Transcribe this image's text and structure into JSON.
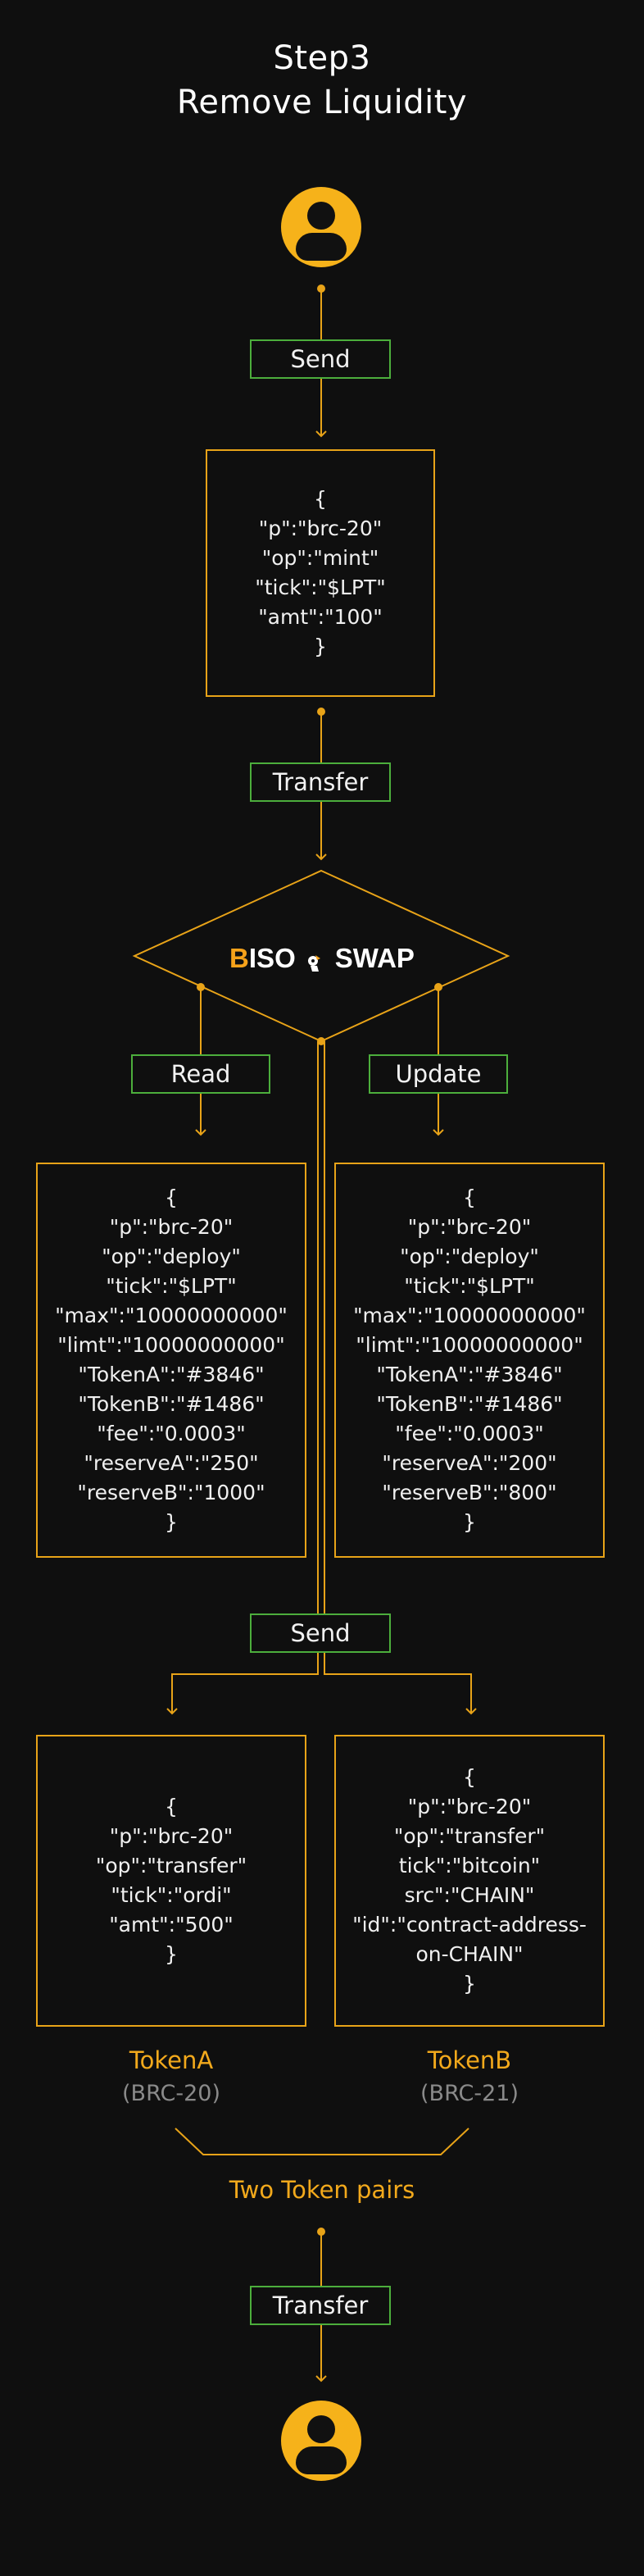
{
  "title": {
    "line1": "Step3",
    "line2": "Remove Liquidity"
  },
  "steps": {
    "send_top": "Send",
    "transfer_top": "Transfer",
    "read": "Read",
    "update": "Update",
    "send_mid": "Send",
    "transfer_bottom": "Transfer"
  },
  "logo": {
    "prefix_letter": "B",
    "prefix_rest": "ISO",
    "suffix": "SWAP",
    "mascot": "pony-icon"
  },
  "boxes": {
    "mint": [
      "{",
      "\"p\":\"brc-20\"",
      "\"op\":\"mint\"",
      "\"tick\":\"$LPT\"",
      "\"amt\":\"100\"",
      "}"
    ],
    "deploy_left": [
      "{",
      "\"p\":\"brc-20\"",
      "\"op\":\"deploy\"",
      "\"tick\":\"$LPT\"",
      "\"max\":\"10000000000\"",
      "\"limt\":\"10000000000\"",
      "\"TokenA\":\"#3846\"",
      "\"TokenB\":\"#1486\"",
      "\"fee\":\"0.0003\"",
      "\"reserveA\":\"250\"",
      "\"reserveB\":\"1000\"",
      "}"
    ],
    "deploy_right": [
      "{",
      "\"p\":\"brc-20\"",
      "\"op\":\"deploy\"",
      "\"tick\":\"$LPT\"",
      "\"max\":\"10000000000\"",
      "\"limt\":\"10000000000\"",
      "\"TokenA\":\"#3846\"",
      "\"TokenB\":\"#1486\"",
      "\"fee\":\"0.0003\"",
      "\"reserveA\":\"200\"",
      "\"reserveB\":\"800\"",
      "}"
    ],
    "token_a": [
      "{",
      "\"p\":\"brc-20\"",
      "\"op\":\"transfer\"",
      "\"tick\":\"ordi\"",
      "\"amt\":\"500\"",
      "}"
    ],
    "token_b": [
      "{",
      "\"p\":\"brc-20\"",
      "\"op\":\"transfer\"",
      "tick\":\"bitcoin\"",
      "src\":\"CHAIN\"",
      "\"id\":\"contract-address-",
      "on-CHAIN\"",
      "}"
    ]
  },
  "tokens": {
    "a_name": "TokenA",
    "a_std": "(BRC-20)",
    "b_name": "TokenB",
    "b_std": "(BRC-21)",
    "pairs": "Two Token pairs"
  },
  "colors": {
    "accent": "#e8a318",
    "tag_border": "#4cae3c",
    "background": "#0f0f0f"
  }
}
